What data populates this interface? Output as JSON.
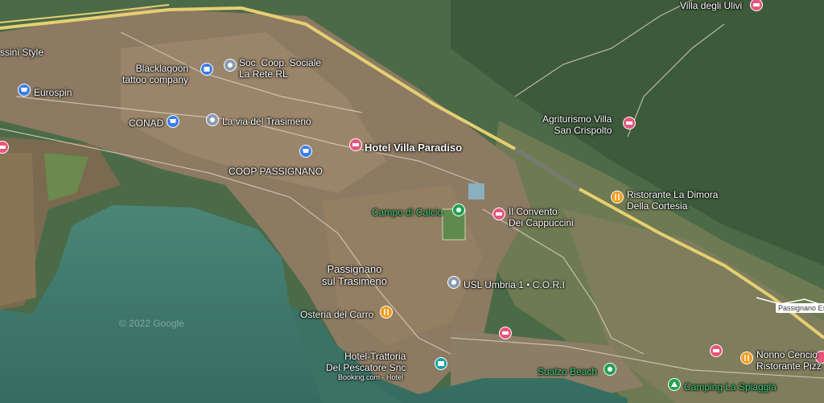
{
  "map": {
    "watermark": "© 2022 Google",
    "road_badge": "Passignano Est",
    "colors": {
      "lake": "#3f7a6b",
      "urban": "#8c7a62",
      "forest": "#3d5a3a",
      "fields": "#7b8b5a",
      "highway": "#e8d27a"
    }
  },
  "places": {
    "villa_ulivi": "Villa degli Ulivi",
    "ssini_style": "ssini Style",
    "blacklagoon": "Blacklagoon\ntattoo company",
    "soc_coop": "Soc. Coop. Sociale\nLa Rete RL",
    "eurospin": "Eurospin",
    "conad": "CONAD",
    "via_trasimeno": "La via del Trasimeno",
    "hotel_paradiso": "Hotel Villa Paradiso",
    "coop": "COOP PASSIGNANO",
    "agriturismo": "Agriturismo Villa\nSan Crispolto",
    "dimora": "Ristorante La Dimora\nDella Cortesia",
    "campo": "Campo di Calcio",
    "convento": "Il Convento\nDei Cappuccini",
    "passignano": "Passignano\nsul Trasimeno",
    "usl": "USL Umbria 1 • C.O.R.I",
    "osteria": "Osteria del Carro",
    "hotel_trattoria": "Hotel-Trattoria\nDel Pescatore Snc",
    "booking": "Booking.com · Hotel",
    "sualzo": "Sualzo Beach",
    "camping": "Camping La Spiaggia",
    "nonno": "Nonno Cencio\nRistorante Pizz"
  }
}
